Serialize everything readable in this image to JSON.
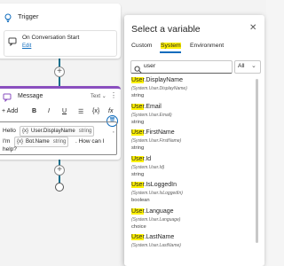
{
  "canvas": {
    "trigger": {
      "label": "Trigger",
      "sub_title": "On Conversation Start",
      "edit_label": "Edit"
    },
    "message": {
      "label": "Message",
      "type_label": "Text",
      "more_label": "⋮",
      "toolbar": {
        "add_label": "+ Add",
        "bold_label": "B",
        "italic_label": "I",
        "underline_label": "U",
        "list_label": "☰",
        "var_label": "{x}",
        "fx_label": "fx"
      },
      "body": {
        "hello": "Hello",
        "chip1_name": "User.DisplayName",
        "chip1_type": "string",
        "chip1_comma": ",",
        "im": "I'm",
        "chip2_name": "Bot.Name",
        "chip2_type": "string",
        "how": ". How can I",
        "help": "help?"
      }
    },
    "plus_label": "+"
  },
  "dialog": {
    "title": "Select a variable",
    "close_label": "✕",
    "tabs": [
      {
        "label": "Custom",
        "active": false
      },
      {
        "label": "System",
        "active": true
      },
      {
        "label": "Environment",
        "active": false
      }
    ],
    "search": {
      "value": "user",
      "placeholder": "Search"
    },
    "filter": {
      "value": "All"
    },
    "variables": [
      {
        "hl": "User",
        "rest": ".DisplayName",
        "path": "(System.User.DisplayName)",
        "type": "string"
      },
      {
        "hl": "User",
        "rest": ".Email",
        "path": "(System.User.Email)",
        "type": "string"
      },
      {
        "hl": "User",
        "rest": ".FirstName",
        "path": "(System.User.FirstName)",
        "type": "string"
      },
      {
        "hl": "User",
        "rest": ".Id",
        "path": "(System.User.Id)",
        "type": "string"
      },
      {
        "hl": "User",
        "rest": ".IsLoggedIn",
        "path": "(System.User.IsLoggedIn)",
        "type": "boolean"
      },
      {
        "hl": "User",
        "rest": ".Language",
        "path": "(System.User.Language)",
        "type": "choice"
      },
      {
        "hl": "User",
        "rest": ".LastName",
        "path": "(System.User.LastName)",
        "type": ""
      }
    ]
  },
  "colors": {
    "accent": "#0f6cbd",
    "connector": "#0f6e8c",
    "message_accent": "#8a4fbf",
    "highlight": "#fff200"
  }
}
